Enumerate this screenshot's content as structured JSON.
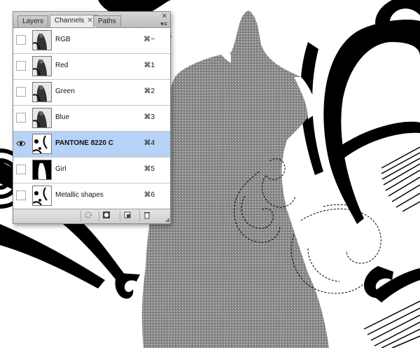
{
  "tabs": [
    {
      "label": "Layers",
      "active": false
    },
    {
      "label": "Channels",
      "active": true
    },
    {
      "label": "Paths",
      "active": false
    }
  ],
  "window_controls": {
    "close_glyph": "✕",
    "menu_glyph": "▾≡"
  },
  "channels": [
    {
      "name": "RGB",
      "shortcut": "⌘~",
      "visible": false,
      "thumb": "photo"
    },
    {
      "name": "Red",
      "shortcut": "⌘1",
      "visible": false,
      "thumb": "photo"
    },
    {
      "name": "Green",
      "shortcut": "⌘2",
      "visible": false,
      "thumb": "photo"
    },
    {
      "name": "Blue",
      "shortcut": "⌘3",
      "visible": false,
      "thumb": "photo"
    },
    {
      "name": "PANTONE 8220 C",
      "shortcut": "⌘4",
      "visible": true,
      "selected": true,
      "thumb": "shapes"
    },
    {
      "name": "Girl",
      "shortcut": "⌘5",
      "visible": false,
      "thumb": "mask"
    },
    {
      "name": "Metallic shapes",
      "shortcut": "⌘6",
      "visible": false,
      "thumb": "shapes"
    }
  ],
  "footer_buttons": [
    {
      "icon": "load-selection-icon"
    },
    {
      "icon": "save-selection-icon"
    },
    {
      "icon": "new-channel-icon"
    },
    {
      "icon": "trash-icon"
    }
  ],
  "colors": {
    "selection": "#b6d3f7",
    "panel": "#ececec"
  }
}
